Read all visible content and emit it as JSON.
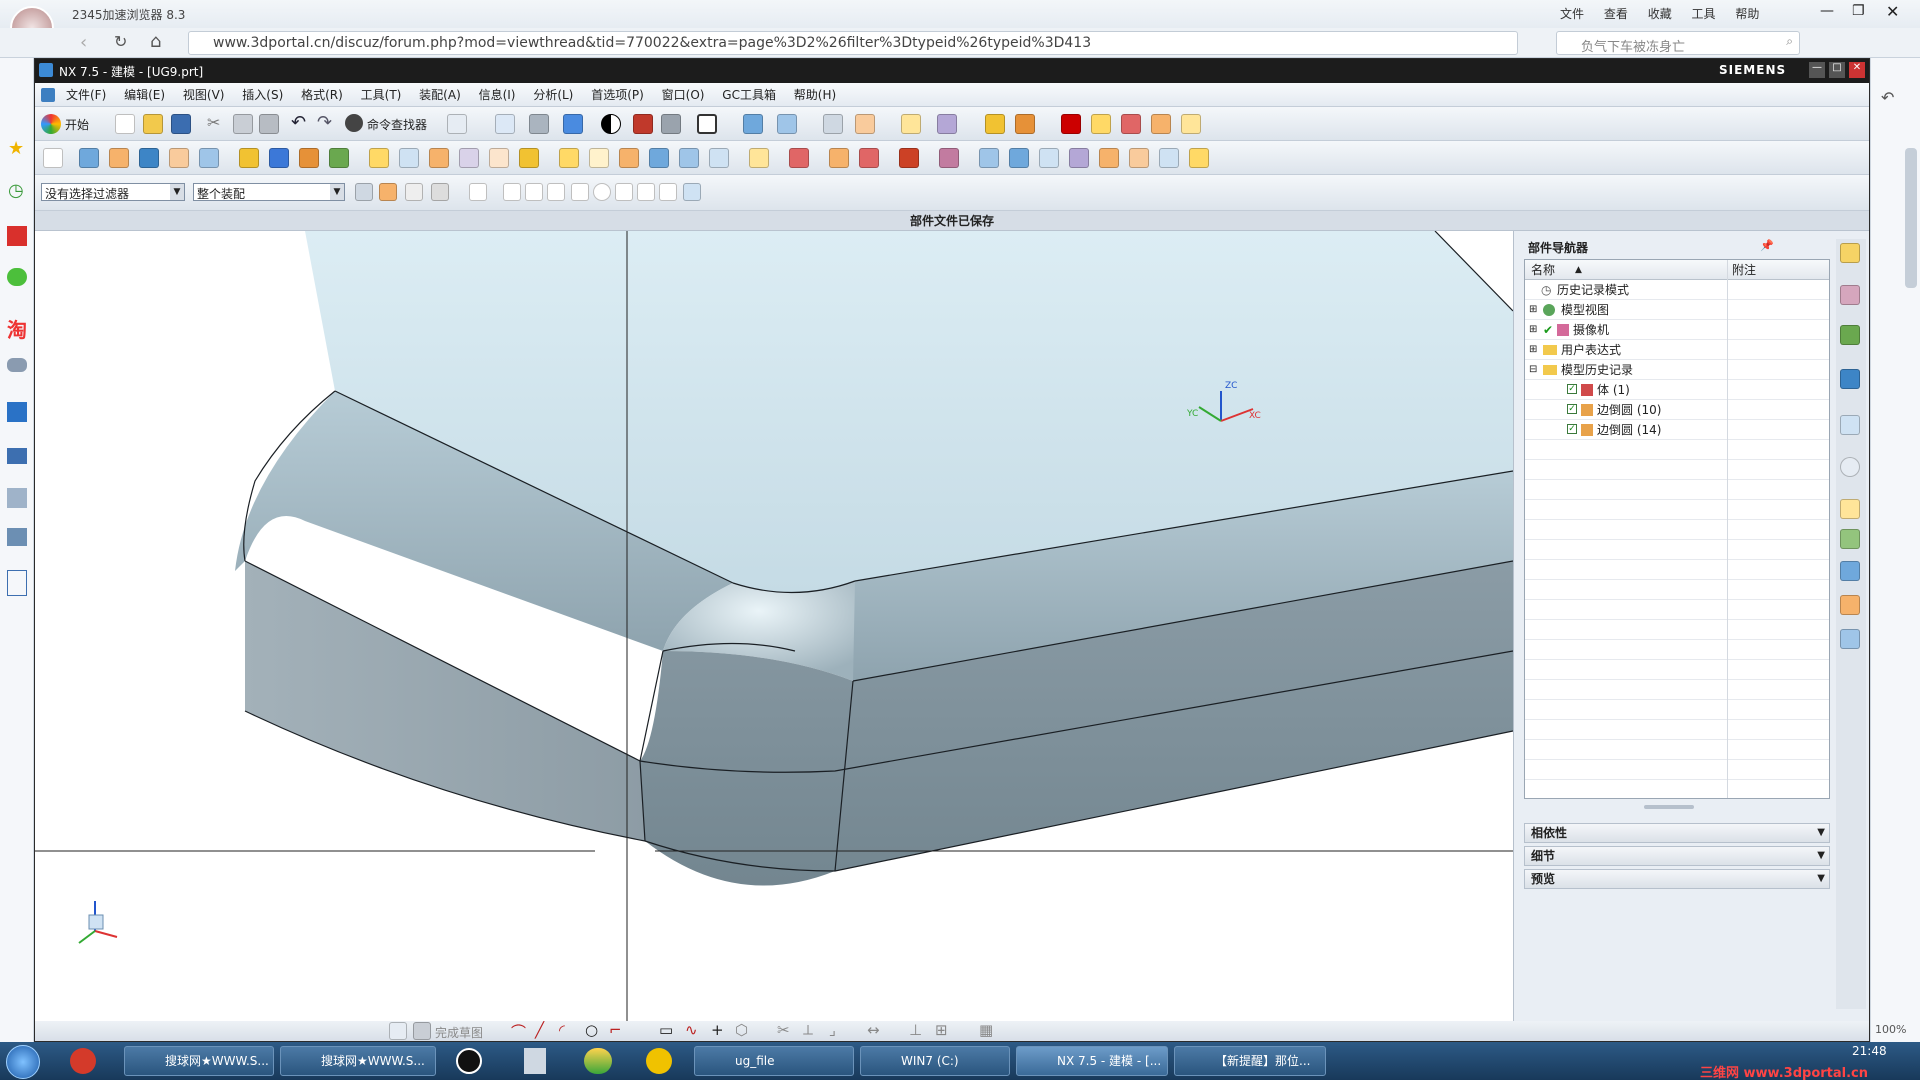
{
  "browser": {
    "app_title": "2345加速浏览器 8.3",
    "menu": [
      "文件",
      "查看",
      "收藏",
      "工具",
      "帮助"
    ],
    "url": "www.3dportal.cn/discuz/forum.php?mod=viewthread&tid=770022&extra=page%3D2%26filter%3Dtypeid%26typeid%3D413",
    "search_placeholder": "负气下车被冻身亡",
    "zoom": "100%"
  },
  "nx": {
    "title": "NX 7.5 - 建模 - [UG9.prt]",
    "brand": "SIEMENS",
    "menu": [
      "文件(F)",
      "编辑(E)",
      "视图(V)",
      "插入(S)",
      "格式(R)",
      "工具(T)",
      "装配(A)",
      "信息(I)",
      "分析(L)",
      "首选项(P)",
      "窗口(O)",
      "GC工具箱",
      "帮助(H)"
    ],
    "toolbar": {
      "start_label": "开始",
      "command_finder_label": "命令查找器"
    },
    "filters": {
      "selection_filter": "没有选择过滤器",
      "assembly_scope": "整个装配"
    },
    "status_message": "部件文件已保存",
    "bottom_toolbar": {
      "finish_sketch": "完成草图"
    },
    "axes": {
      "z": "ZC",
      "y": "YC",
      "x": "XC"
    }
  },
  "navigator": {
    "title": "部件导航器",
    "columns": [
      "名称",
      "附注"
    ],
    "items": [
      {
        "label": "历史记录模式",
        "depth": 0,
        "checked": false
      },
      {
        "label": "模型视图",
        "depth": 0,
        "checked": false
      },
      {
        "label": "摄像机",
        "depth": 0,
        "checked": true
      },
      {
        "label": "用户表达式",
        "depth": 0,
        "checked": false
      },
      {
        "label": "模型历史记录",
        "depth": 0,
        "checked": false
      },
      {
        "label": "体 (1)",
        "depth": 1,
        "checked": true
      },
      {
        "label": "边倒圆 (10)",
        "depth": 1,
        "checked": true
      },
      {
        "label": "边倒圆 (14)",
        "depth": 1,
        "checked": true
      }
    ],
    "sections": [
      "相依性",
      "细节",
      "预览"
    ]
  },
  "taskbar": {
    "items": [
      "搜球网★WWW.S...",
      "搜球网★WWW.S...",
      "ug_file",
      "WIN7 (C:)",
      "NX 7.5 - 建模 - [...",
      "【新提醒】那位..."
    ],
    "time": "21:48",
    "watermark": "三维网 www.3dportal.cn"
  }
}
